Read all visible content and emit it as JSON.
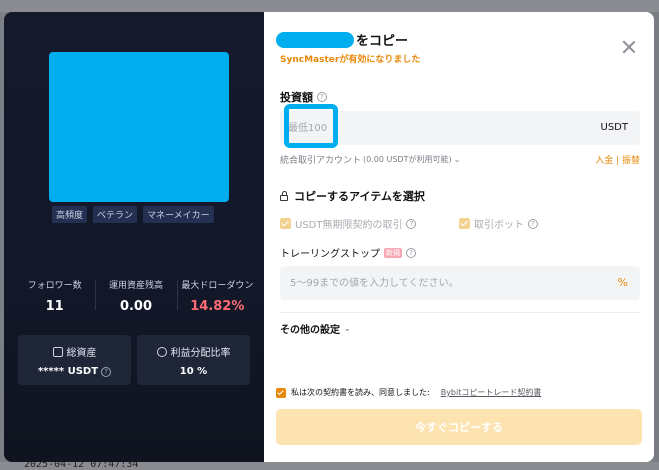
{
  "background": {
    "date": "2025-04-12 07:47:34"
  },
  "trader": {
    "tags": [
      "高頻度",
      "ベテラン",
      "マネーメイカー"
    ],
    "stats": [
      {
        "label": "フォロワー数",
        "value": "11"
      },
      {
        "label": "運用資産残高",
        "value": "0.00"
      },
      {
        "label": "最大ドローダウン",
        "value": "14.82%"
      }
    ],
    "cards": [
      {
        "icon": "wallet-icon",
        "label": "総資産",
        "value": "***** USDT"
      },
      {
        "icon": "pie-chart-icon",
        "label": "利益分配比率",
        "value": "10 %"
      }
    ]
  },
  "dialog": {
    "title_suffix": "をコピー",
    "subtitle": "SyncMasterが有効になりました",
    "amount_label": "投資額",
    "amount_placeholder": "最低100",
    "amount_unit": "USDT",
    "account_label": "統合取引アカウント",
    "account_available": "(0.00 USDTが利用可能)",
    "deposit_link": "入金 | 振替",
    "items_label": "コピーするアイテムを選択",
    "items": [
      {
        "label": "USDT無期限契約の取引",
        "checked": true
      },
      {
        "label": "取引ボット",
        "checked": true
      }
    ],
    "trailing_label": "トレーリングストップ",
    "trailing_badge": "新規",
    "trailing_placeholder": "5～99までの値を入力してください。",
    "trailing_unit": "%",
    "more_settings": "その他の設定",
    "agree_text": "私は次の契約書を読み、同意しました:",
    "agree_link": "Bybitコピートレード契約書",
    "copy_button": "今すぐコピーする"
  }
}
